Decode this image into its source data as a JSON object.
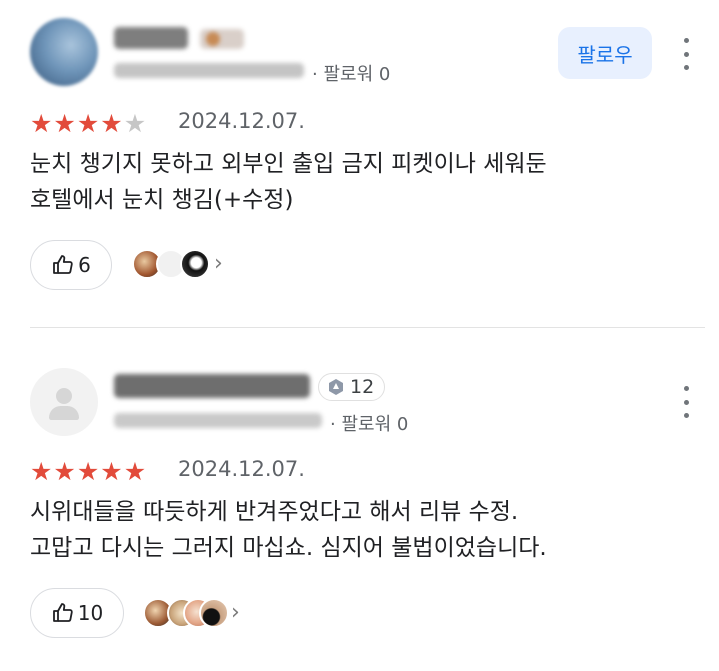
{
  "reviews": [
    {
      "follow_label": "팔로우",
      "follower_text": "· 팔로워 0",
      "rating": 4,
      "date": "2024.12.07.",
      "text_lines": [
        "눈치 챙기지 못하고 외부인 출입 금지 피켓이나 세워둔",
        "호텔에서 눈치 챙김(+수정)"
      ],
      "like_count": "6",
      "reaction_avatars": [
        "food-photo",
        "default-avatar",
        "panda-photo"
      ],
      "icons": [
        "thumbs-up-icon",
        "chevron-right-icon",
        "more-vertical-icon"
      ]
    },
    {
      "level_badge": "12",
      "follower_text": "· 팔로워 0",
      "rating": 5,
      "date": "2024.12.07.",
      "text_lines": [
        "시위대들을 따듯하게 반겨주었다고 해서 리뷰 수정.",
        "고맙고 다시는 그러지 마십쇼. 심지어 불법이었습니다."
      ],
      "like_count": "10",
      "reaction_avatars": [
        "food-photo",
        "dish-photo",
        "sticker-photo",
        "dark-photo"
      ],
      "icons": [
        "thumbs-up-icon",
        "chevron-right-icon",
        "more-vertical-icon",
        "level-badge-icon"
      ]
    }
  ],
  "colors": {
    "star_on": "#e24b3b",
    "star_off": "#c6c6c6",
    "follow_bg": "#e8f0fe",
    "follow_text": "#1a73e8"
  }
}
